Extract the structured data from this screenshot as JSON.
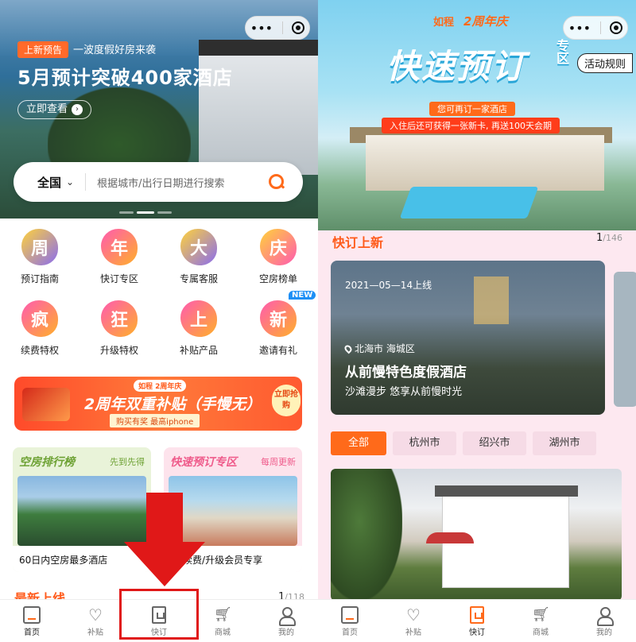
{
  "left": {
    "hero": {
      "tag": "上新预告",
      "subtitle": "一波度假好房来袭",
      "title": "5月预计突破400家酒店",
      "cta": "立即查看"
    },
    "capsule": {
      "more": "•••"
    },
    "search": {
      "region": "全国",
      "placeholder": "根据城市/出行日期进行搜索"
    },
    "icons": [
      {
        "glyph": "周",
        "label": "预订指南",
        "color": "#8a6cf0"
      },
      {
        "glyph": "年",
        "label": "快订专区",
        "color": "#ff9a2a"
      },
      {
        "glyph": "大",
        "label": "专属客服",
        "color": "#8a6cf0"
      },
      {
        "glyph": "庆",
        "label": "空房榜单",
        "color": "#ff6aa0"
      },
      {
        "glyph": "疯",
        "label": "续费特权",
        "color": "#ff6a3a"
      },
      {
        "glyph": "狂",
        "label": "升级特权",
        "color": "#ff6a3a"
      },
      {
        "glyph": "上",
        "label": "补贴产品",
        "color": "#ff6a3a"
      },
      {
        "glyph": "新",
        "label": "邀请有礼",
        "color": "#ff6a3a",
        "badge": "NEW"
      }
    ],
    "promo": {
      "logo": "如程 2周年庆",
      "title": "2周年双重补贴（手慢无）",
      "sub": "购买有奖  最高iphone",
      "button": "立即抢购"
    },
    "cards": [
      {
        "title": "空房排行榜",
        "side": "先到先得",
        "footer": "60日内空房最多酒店"
      },
      {
        "title": "快速预订专区",
        "side": "每周更新",
        "footer": "购/续费/升级会员专享"
      }
    ],
    "latest": {
      "title": "最新上线",
      "page": "1",
      "total": "/118"
    },
    "tabbar": [
      {
        "label": "首页"
      },
      {
        "label": "补贴"
      },
      {
        "label": "快订"
      },
      {
        "label": "商城"
      },
      {
        "label": "我的"
      }
    ]
  },
  "right": {
    "brand": {
      "logo": "如程",
      "anniv": "2周年庆"
    },
    "hero": {
      "title": "快速预订",
      "zone": "专区",
      "pill1": "您可再订一家酒店",
      "pill2": "入住后还可获得一张新卡, 再送100天会期"
    },
    "rules": "活动规则",
    "section": {
      "title": "快订上新",
      "page": "1",
      "total": "/146"
    },
    "featured": {
      "date": "2021—05—14上线",
      "location": "北海市 海城区",
      "name": "从前慢特色度假酒店",
      "desc": "沙滩漫步 悠享从前慢时光"
    },
    "cities": [
      "全部",
      "杭州市",
      "绍兴市",
      "湖州市"
    ],
    "tabbar": [
      {
        "label": "首页"
      },
      {
        "label": "补贴"
      },
      {
        "label": "快订"
      },
      {
        "label": "商城"
      },
      {
        "label": "我的"
      }
    ],
    "accent": "#ff6a1a"
  }
}
